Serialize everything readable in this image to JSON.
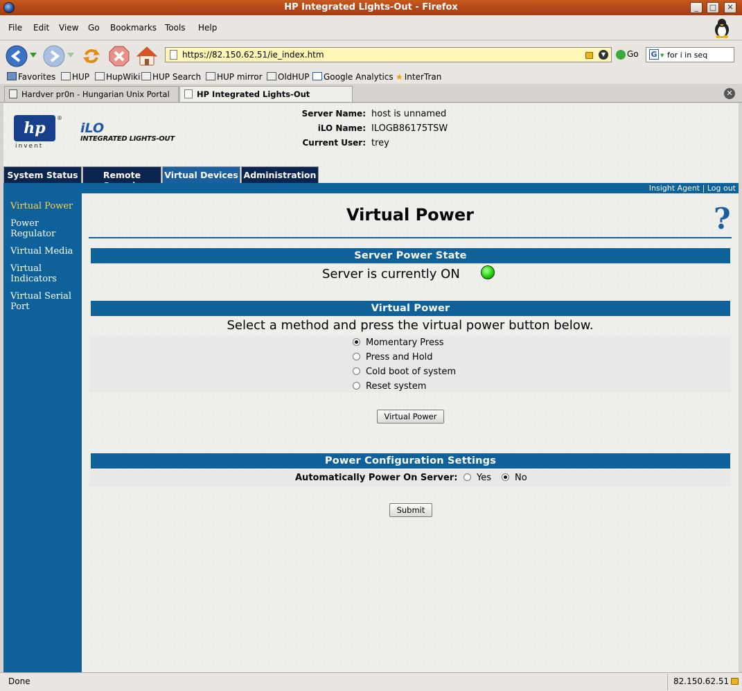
{
  "window": {
    "title": "HP Integrated Lights-Out - Firefox"
  },
  "menu": [
    "File",
    "Edit",
    "View",
    "Go",
    "Bookmarks",
    "Tools",
    "Help"
  ],
  "nav": {
    "url": "https://82.150.62.51/ie_index.htm",
    "go_label": "Go",
    "search_value": "for i in seq"
  },
  "bookmarks": [
    "Favorites",
    "HUP",
    "HupWiki",
    "HUP Search",
    "HUP mirror",
    "OldHUP",
    "Google Analytics",
    "InterTran"
  ],
  "browser_tabs": [
    "Hardver pr0n - Hungarian Unix Portal",
    "HP Integrated Lights-Out"
  ],
  "ilo": {
    "logo_text": "hp",
    "invent": "invent",
    "name": "iLO",
    "subtitle": "INTEGRATED LIGHTS-OUT",
    "server_name_label": "Server Name:",
    "server_name": "host is unnamed",
    "ilo_name_label": "iLO Name:",
    "ilo_name": "ILOGB86175TSW",
    "current_user_label": "Current User:",
    "current_user": "trey"
  },
  "main_tabs": [
    "System Status",
    "Remote Console",
    "Virtual Devices",
    "Administration"
  ],
  "active_main_tab": "Virtual Devices",
  "strip_links": {
    "insight": "Insight Agent",
    "sep": "|",
    "logout": "Log out"
  },
  "sidebar": [
    "Virtual Power",
    "Power Regulator",
    "Virtual Media",
    "Virtual Indicators",
    "Virtual Serial Port"
  ],
  "page": {
    "title": "Virtual Power",
    "help": "?",
    "power_state_header": "Server Power State",
    "power_state_text": "Server is currently ON",
    "power_state_color": "#27d914",
    "virtual_power_header": "Virtual Power",
    "instruction": "Select a method and press the virtual power button below.",
    "methods": [
      "Momentary Press",
      "Press and Hold",
      "Cold boot of system",
      "Reset system"
    ],
    "selected_method": "Momentary Press",
    "virtual_power_button": "Virtual Power",
    "config_header": "Power Configuration Settings",
    "auto_power_label": "Automatically Power On Server:",
    "auto_yes": "Yes",
    "auto_no": "No",
    "auto_selected": "No",
    "submit": "Submit"
  },
  "status": {
    "left": "Done",
    "right": "82.150.62.51"
  }
}
